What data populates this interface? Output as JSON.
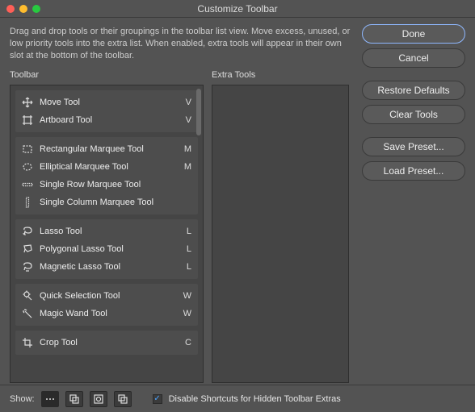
{
  "window": {
    "title": "Customize Toolbar"
  },
  "description": "Drag and drop tools or their groupings in the toolbar list view. Move excess, unused, or low priority tools into the extra list. When enabled, extra tools will appear in their own slot at the bottom of the toolbar.",
  "columns": {
    "toolbar": "Toolbar",
    "extra": "Extra Tools"
  },
  "groups": [
    {
      "tools": [
        {
          "icon": "move",
          "label": "Move Tool",
          "key": "V"
        },
        {
          "icon": "artboard",
          "label": "Artboard Tool",
          "key": "V"
        }
      ]
    },
    {
      "tools": [
        {
          "icon": "rect-marquee",
          "label": "Rectangular Marquee Tool",
          "key": "M"
        },
        {
          "icon": "ellipse-marquee",
          "label": "Elliptical Marquee Tool",
          "key": "M"
        },
        {
          "icon": "row-marquee",
          "label": "Single Row Marquee Tool",
          "key": ""
        },
        {
          "icon": "col-marquee",
          "label": "Single Column Marquee Tool",
          "key": ""
        }
      ]
    },
    {
      "tools": [
        {
          "icon": "lasso",
          "label": "Lasso Tool",
          "key": "L"
        },
        {
          "icon": "poly-lasso",
          "label": "Polygonal Lasso Tool",
          "key": "L"
        },
        {
          "icon": "mag-lasso",
          "label": "Magnetic Lasso Tool",
          "key": "L"
        }
      ]
    },
    {
      "tools": [
        {
          "icon": "quick-select",
          "label": "Quick Selection Tool",
          "key": "W"
        },
        {
          "icon": "magic-wand",
          "label": "Magic Wand Tool",
          "key": "W"
        }
      ]
    },
    {
      "tools": [
        {
          "icon": "crop",
          "label": "Crop Tool",
          "key": "C"
        }
      ]
    }
  ],
  "buttons": {
    "done": "Done",
    "cancel": "Cancel",
    "restore": "Restore Defaults",
    "clear": "Clear Tools",
    "save": "Save Preset...",
    "load": "Load Preset..."
  },
  "footer": {
    "show": "Show:",
    "checkbox": "Disable Shortcuts for Hidden Toolbar Extras",
    "checked": true
  }
}
